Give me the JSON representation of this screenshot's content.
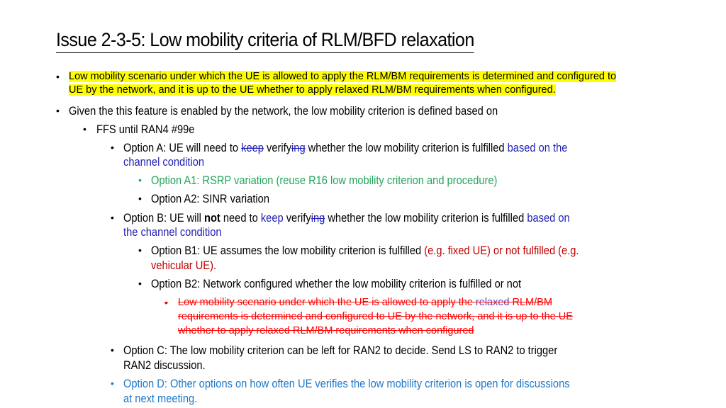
{
  "slide": {
    "title": "Issue 2-3-5: Low mobility criteria of RLM/BFD relaxation",
    "highlighted_note": {
      "line1": "Low mobility scenario under which the UE is allowed to apply the RLM/BM requirements is determined and configured to",
      "line2": "UE by the network, and it is up to the UE whether to apply relaxed RLM/BM requirements when configured."
    },
    "main_bullet": "Given the this feature is enabled by the network, the low mobility criterion is defined based on",
    "ffs": "FFS until RAN4 #99e",
    "option_a": {
      "p1": "Option A: UE will need to ",
      "deleted_keep": "keep",
      "p2": " verify",
      "deleted_ing": "ing",
      "p3": " whether the low mobility criterion is fulfilled ",
      "blue1": "based on the",
      "blue2": "channel condition"
    },
    "option_a1": "Option A1: RSRP variation (reuse R16 low mobility criterion and procedure)",
    "option_a2": "Option A2: SINR variation",
    "option_b": {
      "p1": "Option B: UE will ",
      "bold": "not",
      "p2": " need to ",
      "blue_keep": "keep",
      "p3": " verify",
      "deleted_ing": "ing",
      "p4": " whether the low mobility criterion is fulfilled ",
      "blue1": "based on",
      "blue2": "the channel condition"
    },
    "option_b1": {
      "p1": "Option B1: UE assumes the low mobility criterion is fulfilled ",
      "red1": "(e.g. fixed UE) or not fulfilled (e.g.",
      "red2": "vehicular UE)."
    },
    "option_b2": "Option B2: Network configured whether the low mobility criterion is fulfilled or not",
    "deleted_note": {
      "l1a": "Low mobility scenario under which the UE is allowed to apply the ",
      "l1b": "relaxed",
      "l1c": " RLM/BM",
      "l2": "requirements is determined and configured to UE by the network, and it is up to the UE",
      "l3": "whether to apply relaxed RLM/BM requirements when configured"
    },
    "option_c": {
      "l1": "Option C: The low mobility criterion can be left for RAN2 to decide. Send LS to RAN2 to trigger",
      "l2": "RAN2 discussion."
    },
    "option_d": {
      "l1": "Option D: Other options on how often UE verifies the low mobility criterion is open for discussions",
      "l2": "at next meeting."
    },
    "bullet_glyph": "•"
  },
  "colors": {
    "highlight": "#ffff00",
    "blue_text": "#1f1fb4",
    "green_text": "#22a65a",
    "dark_red_text": "#c00000",
    "strike_red": "#ff0000",
    "light_blue_text": "#1e78c8"
  }
}
